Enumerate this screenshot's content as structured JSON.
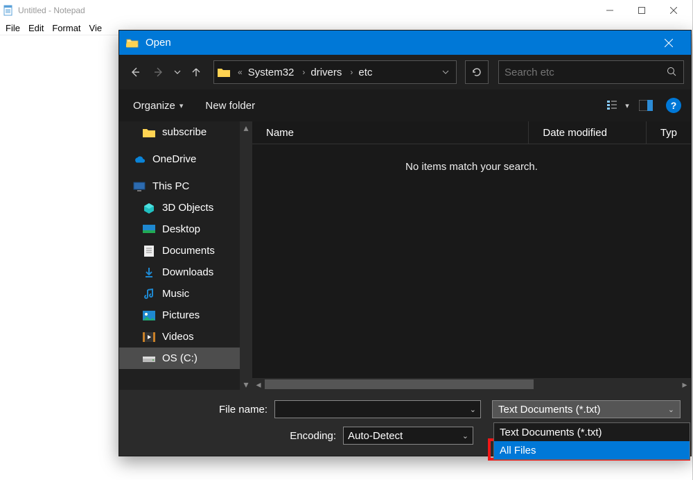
{
  "notepad": {
    "title": "Untitled - Notepad",
    "menus": [
      "File",
      "Edit",
      "Format",
      "Vie"
    ]
  },
  "dialog": {
    "title": "Open",
    "breadcrumb": [
      "System32",
      "drivers",
      "etc"
    ],
    "search_placeholder": "Search etc",
    "toolbar": {
      "organize": "Organize",
      "new_folder": "New folder"
    },
    "nav_items": [
      {
        "label": "subscribe",
        "icon": "folder",
        "indent": true
      },
      {
        "label": "OneDrive",
        "icon": "onedrive",
        "indent": false
      },
      {
        "label": "This PC",
        "icon": "pc",
        "indent": false
      },
      {
        "label": "3D Objects",
        "icon": "3d",
        "indent": true
      },
      {
        "label": "Desktop",
        "icon": "desktop",
        "indent": true
      },
      {
        "label": "Documents",
        "icon": "documents",
        "indent": true
      },
      {
        "label": "Downloads",
        "icon": "downloads",
        "indent": true
      },
      {
        "label": "Music",
        "icon": "music",
        "indent": true
      },
      {
        "label": "Pictures",
        "icon": "pictures",
        "indent": true
      },
      {
        "label": "Videos",
        "icon": "videos",
        "indent": true
      },
      {
        "label": "OS (C:)",
        "icon": "drive",
        "indent": true,
        "selected": true
      }
    ],
    "columns": {
      "name": "Name",
      "date": "Date modified",
      "type": "Typ"
    },
    "empty_message": "No items match your search.",
    "file_name_label": "File name:",
    "file_name_value": "",
    "encoding_label": "Encoding:",
    "encoding_value": "Auto-Detect",
    "file_type_selected": "Text Documents (*.txt)",
    "file_type_options": [
      "Text Documents (*.txt)",
      "All Files"
    ]
  }
}
